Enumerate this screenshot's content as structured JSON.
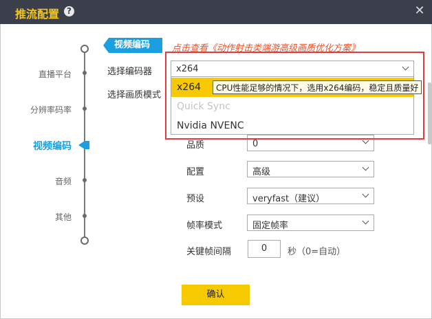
{
  "window": {
    "title": "推流配置",
    "help_icon": "help-icon",
    "close_icon": "close-icon"
  },
  "timeline": [
    {
      "label": "直播平台",
      "active": false
    },
    {
      "label": "分辨率码率",
      "active": false
    },
    {
      "label": "视频编码",
      "active": true
    },
    {
      "label": "音频",
      "active": false
    },
    {
      "label": "其他",
      "active": false
    }
  ],
  "section": {
    "title": "视频编码",
    "link": "点击查看《动作射击类端游高级画质优化方案》"
  },
  "encoder": {
    "label": "选择编码器",
    "value": "x264",
    "options": [
      {
        "label": "x264",
        "state": "selected"
      },
      {
        "label": "Quick Sync",
        "state": "disabled"
      },
      {
        "label": "Nvidia NVENC",
        "state": "normal"
      }
    ],
    "tooltip": "CPU性能足够的情况下，选用x264编码，稳定且质量好"
  },
  "quality_mode": {
    "label": "选择画质模式"
  },
  "quality": {
    "label": "品质",
    "value": "0"
  },
  "profile": {
    "label": "配置",
    "value": "高级"
  },
  "preset": {
    "label": "预设",
    "value": "veryfast（建议）"
  },
  "framerate_mode": {
    "label": "帧率模式",
    "value": "固定帧率"
  },
  "keyframe": {
    "label": "关键帧间隔",
    "value": "0",
    "suffix": "秒（0=自动）"
  },
  "confirm": {
    "label": "确认"
  },
  "colors": {
    "accent": "#1a9fe0",
    "highlight": "#f7c900",
    "title_bar": "#3a3f4b",
    "annotation": "#e03a3a"
  }
}
